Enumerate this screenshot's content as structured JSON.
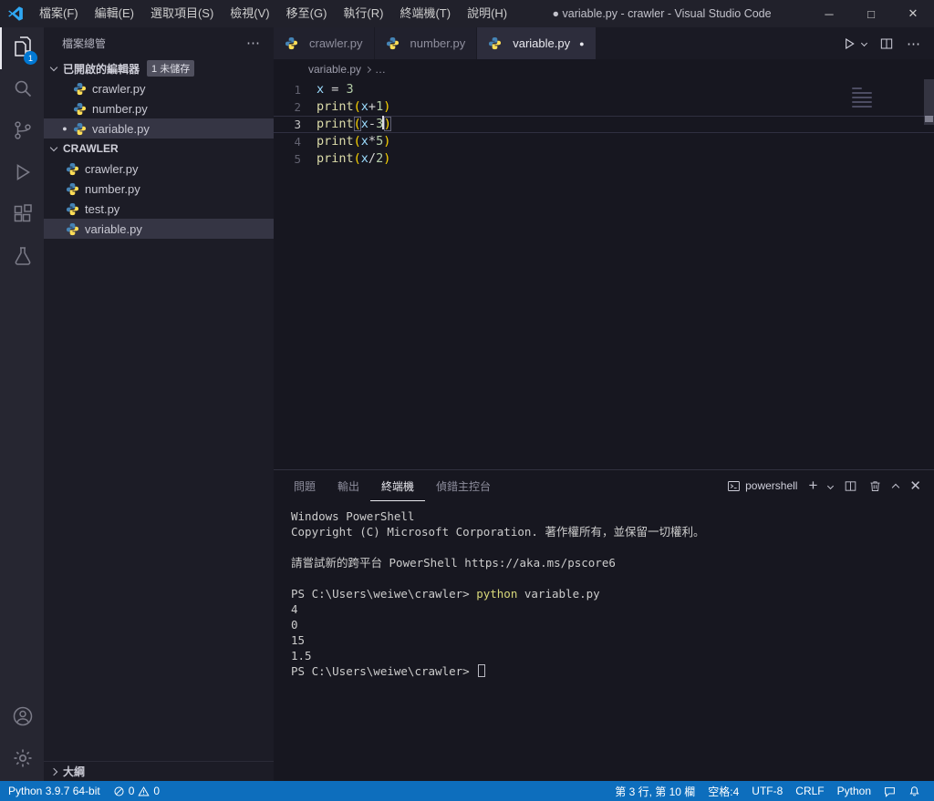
{
  "window": {
    "title": "● variable.py - crawler - Visual Studio Code",
    "menus": [
      "檔案(F)",
      "編輯(E)",
      "選取項目(S)",
      "檢視(V)",
      "移至(G)",
      "執行(R)",
      "終端機(T)",
      "說明(H)"
    ],
    "controls": {
      "minimize": "─",
      "maximize": "□",
      "close": "✕"
    }
  },
  "activity_bar": {
    "explorer_badge": "1"
  },
  "sidebar": {
    "title": "檔案總管",
    "more_label": "⋯",
    "open_editors": {
      "label": "已開啟的編輯器",
      "badge": "1 未儲存",
      "items": [
        {
          "name": "crawler.py",
          "modified": false,
          "selected": false
        },
        {
          "name": "number.py",
          "modified": false,
          "selected": false
        },
        {
          "name": "variable.py",
          "modified": true,
          "selected": true
        }
      ]
    },
    "folder": {
      "label": "CRAWLER",
      "items": [
        {
          "name": "crawler.py",
          "selected": false
        },
        {
          "name": "number.py",
          "selected": false
        },
        {
          "name": "test.py",
          "selected": false
        },
        {
          "name": "variable.py",
          "selected": true
        }
      ]
    },
    "outline_label": "大綱"
  },
  "tabs": [
    {
      "name": "crawler.py",
      "active": false,
      "modified": false
    },
    {
      "name": "number.py",
      "active": false,
      "modified": false
    },
    {
      "name": "variable.py",
      "active": true,
      "modified": true
    }
  ],
  "breadcrumb": {
    "file": "variable.py",
    "more": "…"
  },
  "editor": {
    "code_lines": [
      {
        "num": "1",
        "active": false,
        "tokens": [
          [
            "x",
            "var"
          ],
          [
            " = ",
            "op"
          ],
          [
            "3",
            "num"
          ]
        ]
      },
      {
        "num": "2",
        "active": false,
        "tokens": [
          [
            "print",
            "func"
          ],
          [
            "(",
            "paren"
          ],
          [
            "x",
            "var"
          ],
          [
            "+",
            "op"
          ],
          [
            "1",
            "num"
          ],
          [
            ")",
            "paren"
          ]
        ]
      },
      {
        "num": "3",
        "active": true,
        "tokens": [
          [
            "print",
            "func"
          ],
          [
            "(",
            "paren-hl"
          ],
          [
            "x",
            "var"
          ],
          [
            "-",
            "op"
          ],
          [
            "3",
            "num"
          ],
          [
            "",
            "cursor"
          ],
          [
            ")",
            "paren-hl"
          ]
        ]
      },
      {
        "num": "4",
        "active": false,
        "tokens": [
          [
            "print",
            "func"
          ],
          [
            "(",
            "paren"
          ],
          [
            "x",
            "var"
          ],
          [
            "*",
            "op"
          ],
          [
            "5",
            "num"
          ],
          [
            ")",
            "paren"
          ]
        ]
      },
      {
        "num": "5",
        "active": false,
        "tokens": [
          [
            "print",
            "func"
          ],
          [
            "(",
            "paren"
          ],
          [
            "x",
            "var"
          ],
          [
            "/",
            "op"
          ],
          [
            "2",
            "num"
          ],
          [
            ")",
            "paren"
          ]
        ]
      }
    ]
  },
  "panel": {
    "tabs": [
      {
        "label": "問題",
        "active": false
      },
      {
        "label": "輸出",
        "active": false
      },
      {
        "label": "終端機",
        "active": true
      },
      {
        "label": "偵錯主控台",
        "active": false
      }
    ],
    "shell_label": "powershell",
    "terminal_lines": [
      {
        "text": "Windows PowerShell"
      },
      {
        "text": "Copyright (C) Microsoft Corporation. 著作權所有，並保留一切權利。"
      },
      {
        "text": ""
      },
      {
        "text": "請嘗試新的跨平台 PowerShell https://aka.ms/pscore6"
      },
      {
        "text": ""
      },
      {
        "prompt": "PS C:\\Users\\weiwe\\crawler> ",
        "command": "python",
        "args": " variable.py"
      },
      {
        "text": "4"
      },
      {
        "text": "0"
      },
      {
        "text": "15"
      },
      {
        "text": "1.5"
      },
      {
        "prompt": "PS C:\\Users\\weiwe\\crawler> ",
        "cursor": true
      }
    ]
  },
  "status_bar": {
    "python_version": "Python 3.9.7 64-bit",
    "errors": "0",
    "warnings": "0",
    "right": [
      "第 3 行, 第 10 欄",
      "空格:4",
      "UTF-8",
      "CRLF",
      "Python"
    ]
  },
  "colors": {
    "statusbar": "#0d6ebd",
    "badge": "#0078d4",
    "keyword_func": "#dcdcaa",
    "variable": "#9cdcfe",
    "number": "#b5cea8",
    "bracket": "#ffd700",
    "terminal_command": "#d8d87a"
  }
}
